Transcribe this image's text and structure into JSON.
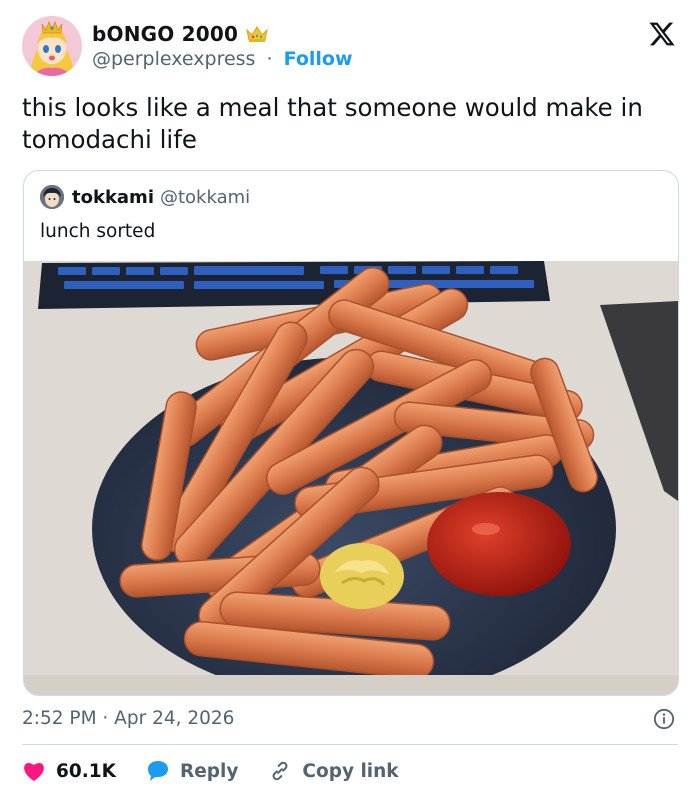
{
  "tweet": {
    "author": {
      "display_name": "bONGO 2000",
      "handle": "@perplexexpress",
      "separator": "·",
      "follow_label": "Follow",
      "badge_icon": "crown-icon"
    },
    "brand_icon": "x-logo-icon",
    "text": "this looks like a meal that someone would make in tomodachi life",
    "timestamp": "2:52 PM · Apr 24, 2026",
    "info_icon": "info-icon"
  },
  "quote": {
    "author": {
      "display_name": "tokkami",
      "handle": "@tokkami"
    },
    "text": "lunch sorted",
    "image": "photo of a plate piled with sausages, ketchup and mustard"
  },
  "actions": {
    "like": {
      "count": "60.1K",
      "icon": "heart-icon",
      "color": "#f91880"
    },
    "reply": {
      "label": "Reply",
      "icon": "speech-bubble-icon",
      "color": "#1d9bf0"
    },
    "copy_link": {
      "label": "Copy link",
      "icon": "link-icon"
    }
  },
  "colors": {
    "link_blue": "#1d9bf0",
    "secondary_text": "#536471",
    "border": "#cfd9de",
    "like_pink": "#f91880"
  }
}
